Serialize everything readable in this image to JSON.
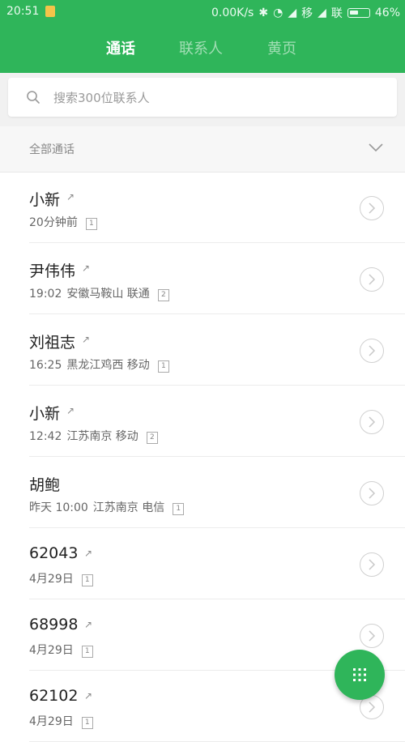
{
  "status_bar": {
    "time": "20:51",
    "speed": "0.00K/s",
    "carrier_1": "移",
    "carrier_2": "联",
    "battery": "46%"
  },
  "tabs": [
    {
      "label": "通话",
      "active": true
    },
    {
      "label": "联系人",
      "active": false
    },
    {
      "label": "黄页",
      "active": false
    }
  ],
  "search": {
    "placeholder": "搜索300位联系人"
  },
  "filter": {
    "label": "全部通话"
  },
  "calls": [
    {
      "name": "小新",
      "outgoing": true,
      "time": "20分钟前",
      "location": "",
      "sim": "1"
    },
    {
      "name": "尹伟伟",
      "outgoing": true,
      "time": "19:02",
      "location": "安徽马鞍山 联通",
      "sim": "2"
    },
    {
      "name": "刘祖志",
      "outgoing": true,
      "time": "16:25",
      "location": "黑龙江鸡西 移动",
      "sim": "1"
    },
    {
      "name": "小新",
      "outgoing": true,
      "time": "12:42",
      "location": "江苏南京 移动",
      "sim": "2"
    },
    {
      "name": "胡鲍",
      "outgoing": false,
      "time": "昨天 10:00",
      "location": "江苏南京 电信",
      "sim": "1"
    },
    {
      "name": "62043",
      "outgoing": true,
      "time": "4月29日",
      "location": "",
      "sim": "1"
    },
    {
      "name": "68998",
      "outgoing": true,
      "time": "4月29日",
      "location": "",
      "sim": "1"
    },
    {
      "name": "62102",
      "outgoing": true,
      "time": "4月29日",
      "location": "",
      "sim": "1"
    }
  ],
  "colors": {
    "accent": "#2fb55a"
  },
  "icons": {
    "search": "search-icon",
    "filter": "chevron-down-icon",
    "detail": "chevron-right-icon",
    "fab": "dialpad-icon",
    "outgoing": "outgoing-call-icon"
  }
}
